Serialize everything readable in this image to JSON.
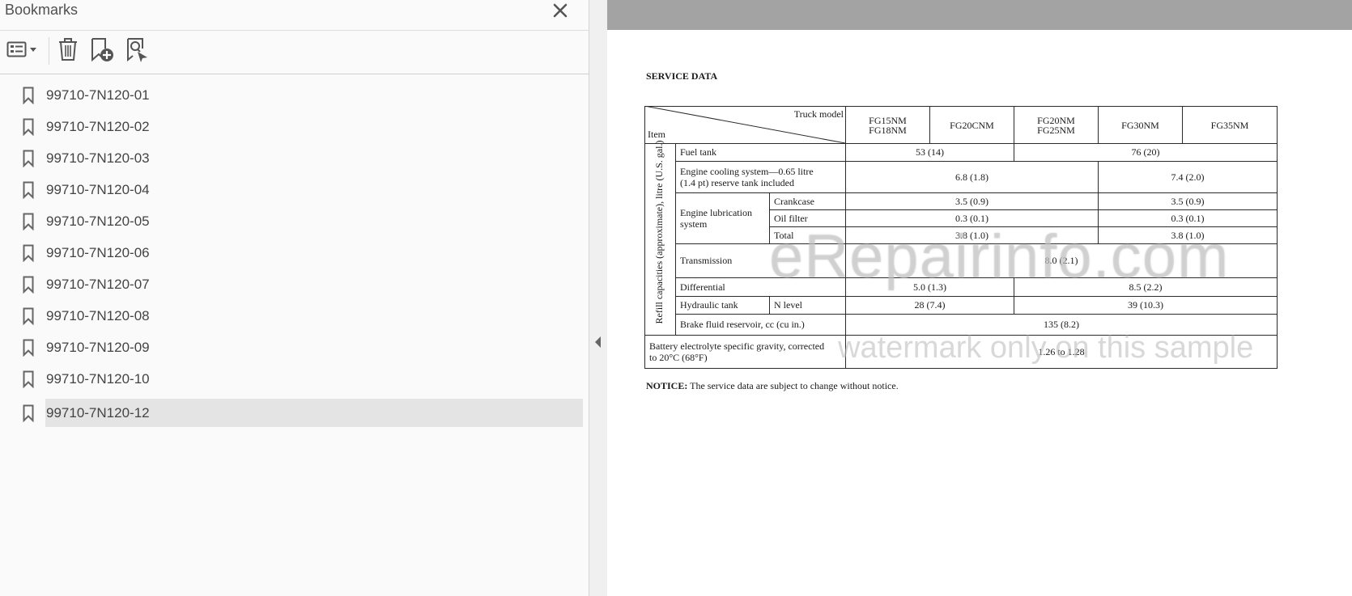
{
  "bookmarks_panel": {
    "title": "Bookmarks",
    "toolbar": {
      "options_icon": "list-options-icon",
      "delete_icon": "trash-icon",
      "new_bookmark_icon": "new-bookmark-icon",
      "find_bookmark_icon": "find-current-bookmark-icon"
    },
    "items": [
      {
        "label": "99710-7N120-01"
      },
      {
        "label": "99710-7N120-02"
      },
      {
        "label": "99710-7N120-03"
      },
      {
        "label": "99710-7N120-04"
      },
      {
        "label": "99710-7N120-05"
      },
      {
        "label": "99710-7N120-06"
      },
      {
        "label": "99710-7N120-07"
      },
      {
        "label": "99710-7N120-08"
      },
      {
        "label": "99710-7N120-09"
      },
      {
        "label": "99710-7N120-10"
      },
      {
        "label": "99710-7N120-12"
      }
    ],
    "selected_index": 10
  },
  "document": {
    "heading": "SERVICE DATA",
    "table": {
      "corner_top": "Truck model",
      "corner_bottom": "Item",
      "models": [
        "FG15NM\nFG18NM",
        "FG20CNM",
        "FG20NM\nFG25NM",
        "FG30NM",
        "FG35NM"
      ],
      "group_label": "Refill capacities (approximate), litre (U.S. gal.)",
      "rows": {
        "fuel_tank": {
          "label": "Fuel tank",
          "v1": "53 (14)",
          "v2": "76 (20)"
        },
        "cooling": {
          "label": "Engine cooling system—0.65 litre\n(1.4 pt) reserve tank included",
          "v1": "6.8 (1.8)",
          "v2": "7.4 (2.0)"
        },
        "lubrication": {
          "label": "Engine lubrication\nsystem",
          "crankcase": {
            "label": "Crankcase",
            "v1": "3.5 (0.9)",
            "v2": "3.5 (0.9)"
          },
          "oil_filter": {
            "label": "Oil filter",
            "v1": "0.3 (0.1)",
            "v2": "0.3 (0.1)"
          },
          "total": {
            "label": "Total",
            "v1": "3.8 (1.0)",
            "v2": "3.8 (1.0)"
          }
        },
        "transmission": {
          "label": "Transmission",
          "value": "8.0 (2.1)"
        },
        "differential": {
          "label": "Differential",
          "v1": "5.0 (1.3)",
          "v2": "8.5 (2.2)"
        },
        "hydraulic": {
          "label": "Hydraulic tank",
          "sub": "N level",
          "v1": "28 (7.4)",
          "v2": "39 (10.3)"
        },
        "brake": {
          "label": "Brake fluid reservoir, cc (cu in.)",
          "value": "135 (8.2)"
        },
        "battery": {
          "label": "Battery electrolyte specific gravity, corrected\nto 20°C (68°F)",
          "value": "1.26 to 1.28"
        }
      }
    },
    "notice_label": "NOTICE:",
    "notice_text": " The service data are subject to change without notice.",
    "watermark_main": "eRepairinfo.com",
    "watermark_sub": "watermark only on this sample"
  }
}
